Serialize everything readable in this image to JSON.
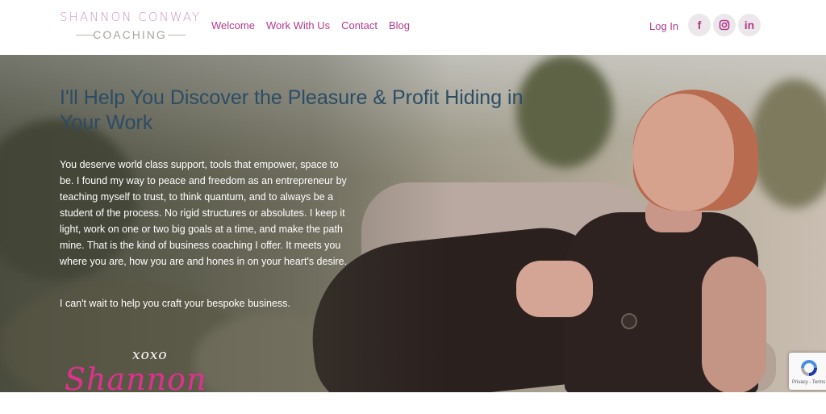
{
  "header": {
    "logo": {
      "line1": "SHANNON CONWAY",
      "line2": "COACHING"
    },
    "nav": [
      {
        "label": "Welcome"
      },
      {
        "label": "Work With Us"
      },
      {
        "label": "Contact"
      },
      {
        "label": "Blog"
      }
    ],
    "login_label": "Log In",
    "social": [
      {
        "icon": "facebook-icon",
        "glyph": "f"
      },
      {
        "icon": "instagram-icon"
      },
      {
        "icon": "linkedin-icon",
        "glyph": "in"
      }
    ]
  },
  "hero": {
    "title": "I'll Help You Discover the Pleasure & Profit Hiding in Your Work",
    "paragraph1": "You deserve world class support, tools that empower, space to be. I found my way to peace and freedom as an entrepreneur by teaching myself to trust, to think quantum, and to always be a student of the process. No rigid structures or absolutes. I keep it light, work on one or two big goals at a time, and make the path mine. That is the kind of business coaching I offer. It meets you where you are, how you are and hones in on your heart's desire.",
    "paragraph2": "I can't wait to help you craft your bespoke business.",
    "signature_xoxo": "xoxo",
    "signature_name": "Shannon"
  },
  "recaptcha": {
    "text": "Privacy - Terms"
  },
  "colors": {
    "brand_pink": "#b23a8c",
    "signature_pink": "#e0318f",
    "title_blue": "#2b4c64",
    "logo_pink": "#c99ac0"
  }
}
